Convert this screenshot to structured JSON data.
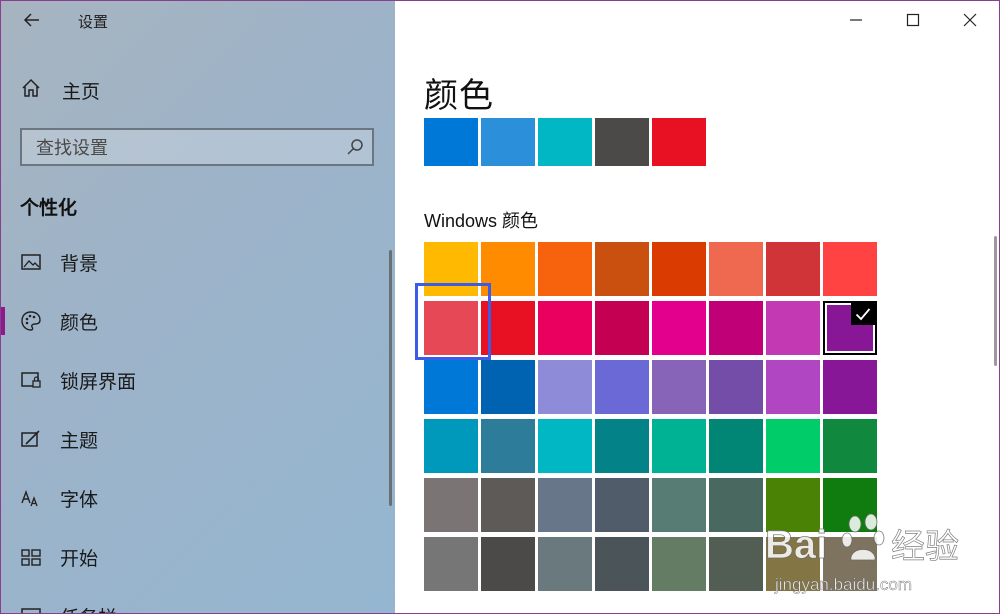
{
  "window": {
    "title": "设置"
  },
  "sidebar": {
    "home_label": "主页",
    "search_placeholder": "查找设置",
    "section_title": "个性化",
    "items": [
      {
        "label": "背景",
        "icon": "picture-icon"
      },
      {
        "label": "颜色",
        "icon": "palette-icon",
        "active": true
      },
      {
        "label": "锁屏界面",
        "icon": "lockscreen-icon"
      },
      {
        "label": "主题",
        "icon": "theme-brush-icon"
      },
      {
        "label": "字体",
        "icon": "font-icon"
      },
      {
        "label": "开始",
        "icon": "start-grid-icon"
      },
      {
        "label": "任务栏",
        "icon": "taskbar-icon"
      }
    ]
  },
  "main": {
    "heading": "颜色",
    "recent_colors": [
      "#0078d7",
      "#2b90d9",
      "#00b7c3",
      "#4c4a48",
      "#e81123"
    ],
    "windows_colors_label": "Windows 颜色",
    "selected_color": "#881798",
    "colors": [
      [
        "#ffb900",
        "#ff8c00",
        "#f7630c",
        "#ca5010",
        "#da3b01",
        "#ef6950",
        "#d13438",
        "#ff4343"
      ],
      [
        "#e74856",
        "#e81123",
        "#ea005e",
        "#c30052",
        "#e3008c",
        "#bf0077",
        "#c239b3",
        "#881798"
      ],
      [
        "#0078d7",
        "#0063b1",
        "#8e8cd8",
        "#6b69d6",
        "#8764b8",
        "#744da9",
        "#b146c2",
        "#881798"
      ],
      [
        "#0099bc",
        "#2d7d9a",
        "#00b7c3",
        "#038387",
        "#00b294",
        "#018574",
        "#00cc6a",
        "#10893e"
      ],
      [
        "#7a7574",
        "#5d5a58",
        "#68768a",
        "#515c6b",
        "#567c73",
        "#486860",
        "#498205",
        "#107c10"
      ],
      [
        "#767676",
        "#4c4a48",
        "#69797e",
        "#4a5459",
        "#647c64",
        "#525e54",
        "#847545",
        "#7e735f"
      ]
    ]
  },
  "watermark": {
    "brand": "Bai",
    "brand_cn": "经验",
    "url": "jingyan.baidu.com"
  }
}
